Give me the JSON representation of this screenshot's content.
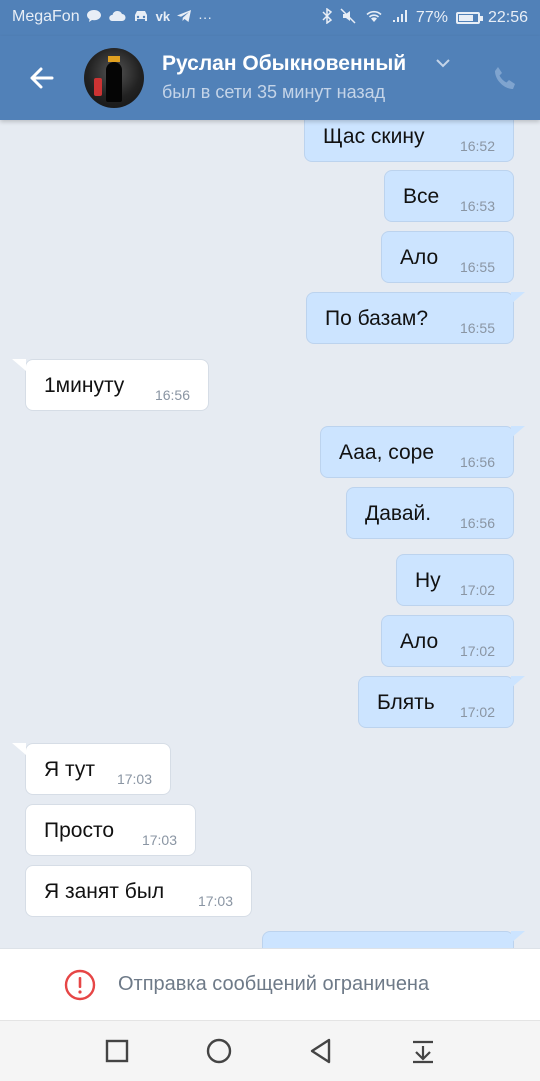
{
  "status_bar": {
    "carrier": "MegaFon",
    "battery_percent": "77%",
    "battery_level": 0.77,
    "time": "22:56",
    "left_icons": [
      "chat-bubble-icon",
      "cloud-icon",
      "car-icon",
      "vk-icon",
      "telegram-icon",
      "more-icon"
    ],
    "right_icons": [
      "bluetooth-icon",
      "mute-icon",
      "wifi-icon",
      "signal-icon",
      "battery-icon"
    ]
  },
  "header": {
    "contact_name": "Руслан Обыкновенный",
    "last_seen": "был в сети 35 минут назад",
    "icons": [
      "back-arrow-icon",
      "chevron-down-icon",
      "phone-icon"
    ]
  },
  "messages": [
    {
      "dir": "out",
      "text": "Щас скину",
      "time": "16:52"
    },
    {
      "dir": "out",
      "text": "Все",
      "time": "16:53"
    },
    {
      "dir": "out",
      "text": "Ало",
      "time": "16:55"
    },
    {
      "dir": "out",
      "text": "По базам?",
      "time": "16:55"
    },
    {
      "dir": "in",
      "text": "1минуту",
      "time": "16:56"
    },
    {
      "dir": "out",
      "text": "Ааа, соре",
      "time": "16:56"
    },
    {
      "dir": "out",
      "text": "Давай.",
      "time": "16:56"
    },
    {
      "dir": "out",
      "text": "Ну",
      "time": "17:02"
    },
    {
      "dir": "out",
      "text": "Ало",
      "time": "17:02"
    },
    {
      "dir": "out",
      "text": "Блять",
      "time": "17:02"
    },
    {
      "dir": "in",
      "text": "Я тут",
      "time": "17:03"
    },
    {
      "dir": "in",
      "text": "Просто",
      "time": "17:03"
    },
    {
      "dir": "in",
      "text": "Я занят был",
      "time": "17:03"
    },
    {
      "dir": "out",
      "text": "",
      "time": ""
    }
  ],
  "restriction_bar": {
    "text": "Отправка сообщений ограничена",
    "icon": "warning-circle-icon",
    "color": "#e64646"
  },
  "nav_bar": {
    "buttons": [
      "recent-apps-icon",
      "home-icon",
      "back-triangle-icon",
      "notification-pull-icon"
    ]
  },
  "colors": {
    "header_bg": "#5181b8",
    "outgoing_bubble": "#cce4ff",
    "incoming_bubble": "#ffffff",
    "chat_bg": "#e6ebf2"
  }
}
